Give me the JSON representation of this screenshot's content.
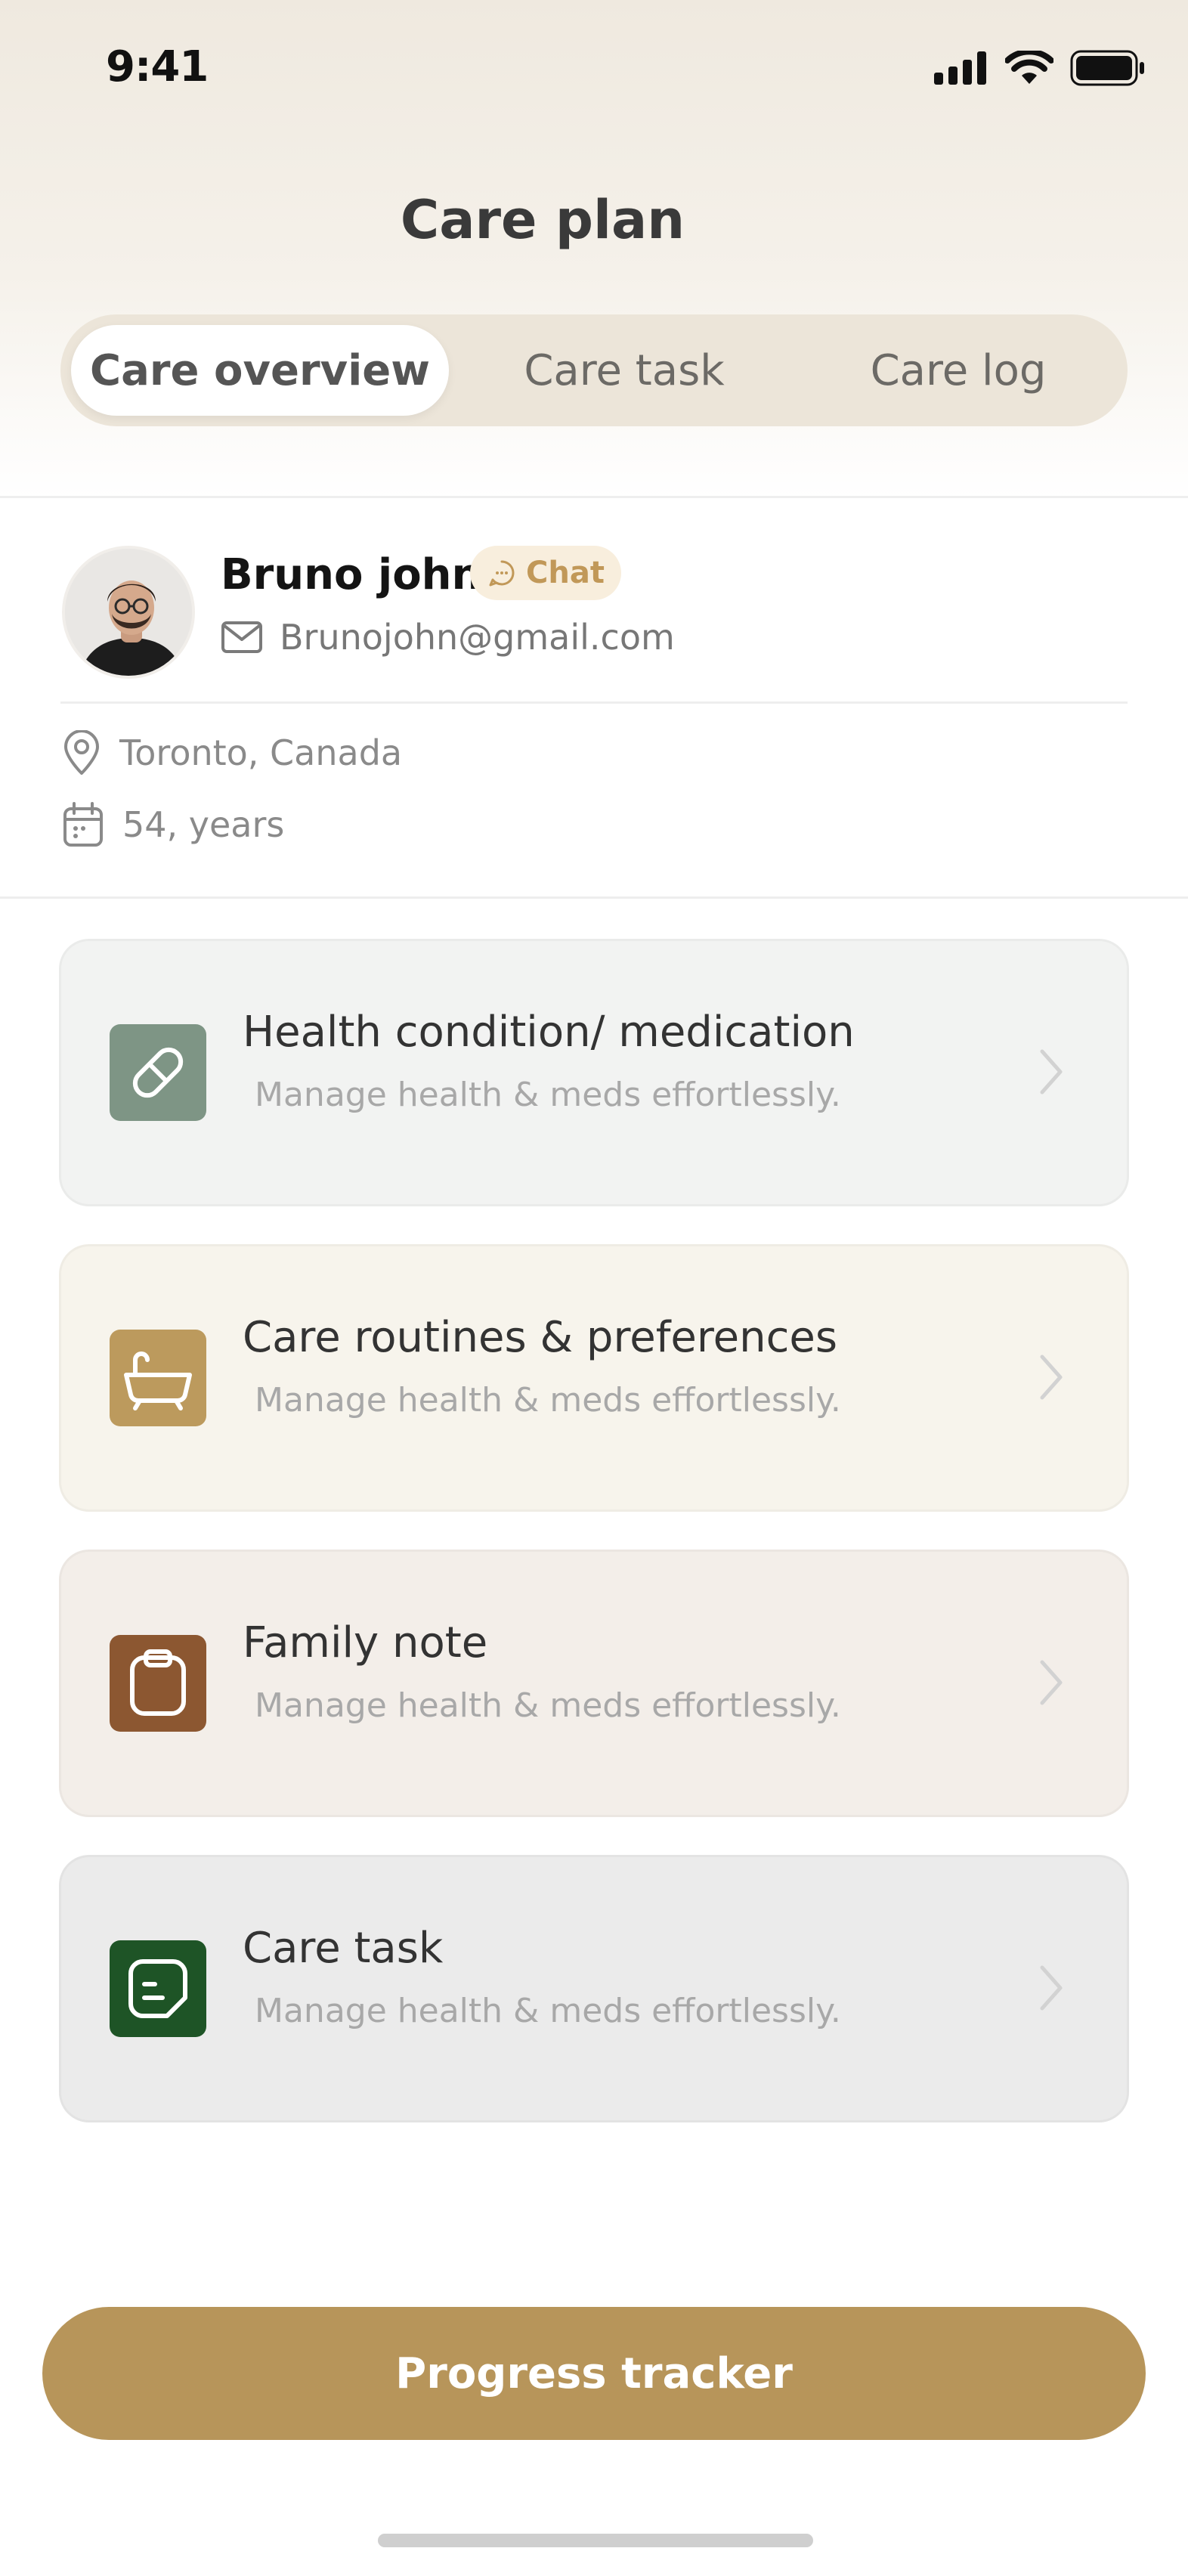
{
  "status_bar": {
    "time": "9:41"
  },
  "header": {
    "title": "Care plan"
  },
  "tabs": [
    {
      "label": "Care overview",
      "active": true
    },
    {
      "label": "Care task",
      "active": false
    },
    {
      "label": "Care log",
      "active": false
    }
  ],
  "profile": {
    "name": "Bruno john",
    "chat_label": "Chat",
    "email": "Brunojohn@gmail.com",
    "location": "Toronto, Canada",
    "age": "54, years"
  },
  "cards": [
    {
      "title": "Health condition/ medication",
      "subtitle": "Manage health & meds effortlessly.",
      "icon": "pill-icon",
      "icon_color": "#7e9585",
      "bg": "#f2f3f2"
    },
    {
      "title": "Care routines & preferences",
      "subtitle": "Manage health & meds effortlessly.",
      "icon": "bathtub-icon",
      "icon_color": "#bc9a5d",
      "bg": "#f7f4ec"
    },
    {
      "title": "Family note",
      "subtitle": "Manage health & meds effortlessly.",
      "icon": "clipboard-icon",
      "icon_color": "#8c5731",
      "bg": "#f3eee9"
    },
    {
      "title": "Care task",
      "subtitle": "Manage health & meds effortlessly.",
      "icon": "note-icon",
      "icon_color": "#1e5426",
      "bg": "#ebebeb"
    }
  ],
  "cta": {
    "label": "Progress tracker"
  },
  "colors": {
    "accent": "#b7955a",
    "chat_text": "#c19858",
    "chat_bg": "#f8eedd"
  }
}
